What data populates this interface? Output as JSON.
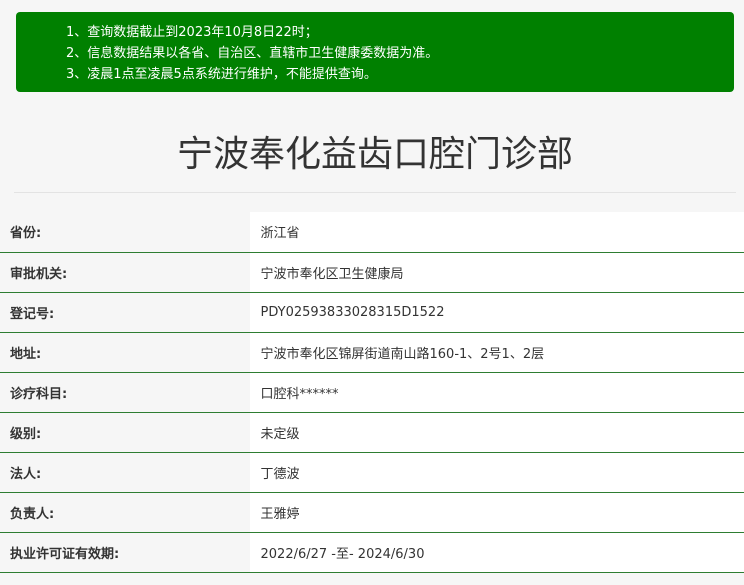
{
  "notice": {
    "lines": [
      "1、查询数据截止到2023年10月8日22时；",
      "2、信息数据结果以各省、自治区、直辖市卫生健康委数据为准。",
      "3、凌晨1点至凌晨5点系统进行维护，不能提供查询。"
    ],
    "background_color": "#008000"
  },
  "title": "宁波奉化益齿口腔门诊部",
  "rows": [
    {
      "label": "省份:",
      "value": "浙江省"
    },
    {
      "label": "审批机关:",
      "value": "宁波市奉化区卫生健康局"
    },
    {
      "label": "登记号:",
      "value": "PDY02593833028315D1522"
    },
    {
      "label": "地址:",
      "value": "宁波市奉化区锦屏街道南山路160-1、2号1、2层"
    },
    {
      "label": "诊疗科目:",
      "value": "口腔科******"
    },
    {
      "label": "级别:",
      "value": "未定级"
    },
    {
      "label": "法人:",
      "value": "丁德波"
    },
    {
      "label": "负责人:",
      "value": "王雅婷"
    },
    {
      "label": "执业许可证有效期:",
      "value": "2022/6/27 -至- 2024/6/30"
    }
  ],
  "row_border_color": "#2e7d32"
}
